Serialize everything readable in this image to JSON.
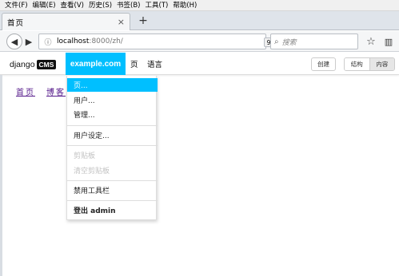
{
  "window_menu": [
    "文件(F)",
    "编辑(E)",
    "查看(V)",
    "历史(S)",
    "书签(B)",
    "工具(T)",
    "帮助(H)"
  ],
  "tab": {
    "title": "首页",
    "close": "×",
    "new_tab": "+"
  },
  "nav": {
    "back": "◀",
    "forward": "▶",
    "info": "ⓘ",
    "url_host": "localhost",
    "url_path": ":8000/zh/",
    "zoom": "90%",
    "reload": "↻",
    "search_placeholder": "搜索",
    "search_icon": "⌕",
    "star": "☆",
    "library": "▥"
  },
  "cms": {
    "logo_text": "django",
    "logo_badge": "CMS",
    "site_name": "example.com",
    "menu_page": "页",
    "menu_language": "语言",
    "create_button": "创建",
    "structure_button": "结构",
    "content_button": "内容"
  },
  "page_links": [
    "首页",
    "博客"
  ],
  "dropdown": {
    "items": [
      {
        "label": "页...",
        "state": "highlighted"
      },
      {
        "label": "用户...",
        "state": "normal"
      },
      {
        "label": "管理...",
        "state": "normal"
      },
      {
        "label": "用户设定...",
        "state": "normal"
      },
      {
        "label": "剪贴板",
        "state": "disabled"
      },
      {
        "label": "清空剪贴板",
        "state": "disabled"
      },
      {
        "label": "禁用工具栏",
        "state": "normal"
      },
      {
        "label": "登出 admin",
        "state": "bold"
      }
    ]
  },
  "colors": {
    "accent": "#00bfff",
    "visited_link": "#551a8b",
    "disabled_text": "#c2c2c2"
  }
}
